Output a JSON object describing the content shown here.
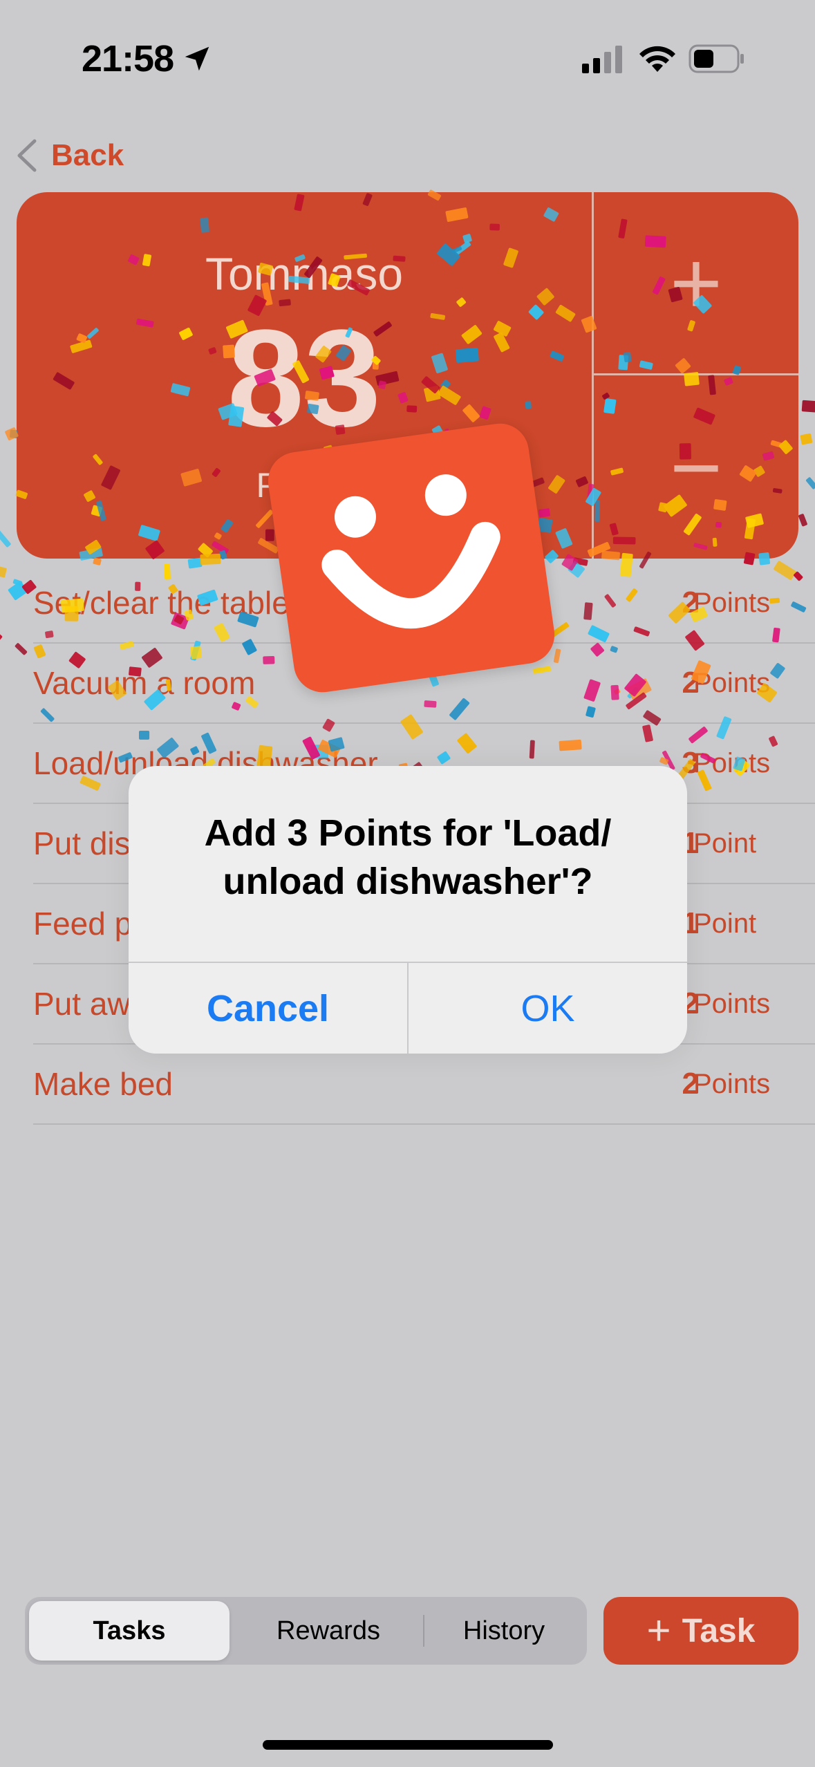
{
  "status_bar": {
    "time": "21:58",
    "icons": [
      "location-arrow-icon",
      "cellular-signal-icon",
      "wifi-icon",
      "battery-icon"
    ]
  },
  "nav": {
    "back_label": "Back"
  },
  "score_card": {
    "name": "Tommaso",
    "points": "83",
    "unit_label": "Points",
    "plus_label": "+",
    "minus_label": "−",
    "color": "#cc472b"
  },
  "tasks": [
    {
      "name": "Set/clear the table",
      "points": "2",
      "unit": "Points"
    },
    {
      "name": "Vacuum a room",
      "points": "2",
      "unit": "Points"
    },
    {
      "name": "Load/unload dishwasher",
      "points": "3",
      "unit": "Points"
    },
    {
      "name": "Put dishes away",
      "points": "1",
      "unit": "Point"
    },
    {
      "name": "Feed pet",
      "points": "1",
      "unit": "Point"
    },
    {
      "name": "Put away toys",
      "points": "2",
      "unit": "Points"
    },
    {
      "name": "Make bed",
      "points": "2",
      "unit": "Points"
    }
  ],
  "alert": {
    "title_line1": "Add 3 Points for 'Load/",
    "title_line2": "unload dishwasher'?",
    "cancel_label": "Cancel",
    "ok_label": "OK",
    "accent": "#1a7bf2"
  },
  "bottom_bar": {
    "segments": [
      "Tasks",
      "Rewards",
      "History"
    ],
    "selected": "Tasks",
    "add_task_label": "Task"
  },
  "colors": {
    "accent": "#cc472b",
    "smiley": "#f0532f",
    "confetti": [
      "#f4b400",
      "#1f8fc4",
      "#c0102e",
      "#ff8a1f",
      "#e0147a",
      "#ffd400",
      "#34c3f0",
      "#9b0b25"
    ]
  }
}
